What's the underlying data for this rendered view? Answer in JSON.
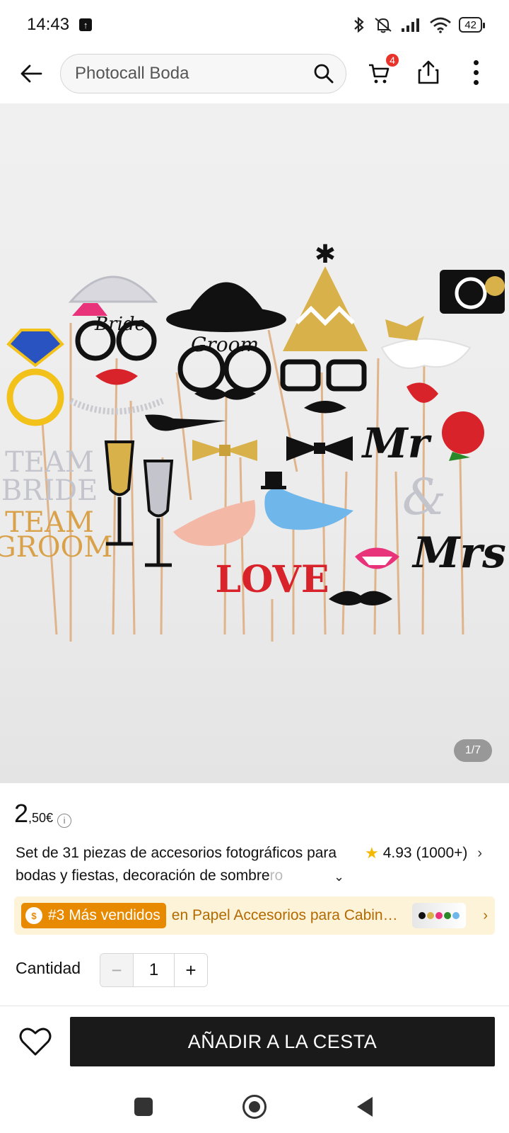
{
  "status_bar": {
    "time": "14:43",
    "battery": "42",
    "icons": [
      "upload-icon",
      "bluetooth-icon",
      "mute-icon",
      "signal-icon",
      "wifi-icon",
      "battery-icon"
    ]
  },
  "top_nav": {
    "search_value": "Photocall Boda",
    "cart_count": "4",
    "icons": [
      "back-arrow-icon",
      "search-icon",
      "cart-icon",
      "share-icon",
      "more-vertical-icon"
    ]
  },
  "gallery": {
    "counter": "1/7",
    "props": {
      "bride": "Bride",
      "groom": "Groom",
      "team_bride_1": "TEAM",
      "team_bride_2": "BRIDE",
      "team_groom_1": "TEAM",
      "team_groom_2": "GROOM",
      "mr": "Mr",
      "amp": "&",
      "mrs": "Mrs",
      "love": "LOVE"
    }
  },
  "product": {
    "price_int": "2",
    "price_dec": ",50€",
    "title_main": "Set de 31 piezas de accesorios fotográficos para bodas y fiestas, decoración de sombre",
    "title_fade": "ro",
    "rating": "4.93",
    "rating_count": "(1000+)"
  },
  "banner": {
    "rank": "#3 Más vendidos",
    "category": "en Papel Accesorios para Cabinas..."
  },
  "quantity": {
    "label": "Cantidad",
    "minus": "−",
    "value": "1",
    "plus": "+"
  },
  "actions": {
    "add_to_cart": "AÑADIR A LA CESTA"
  },
  "colors": {
    "accent_dark": "#1a1a1a",
    "badge_red": "#e8332b",
    "bestseller_orange": "#e88a00",
    "banner_bg": "#fdf3d9",
    "star_yellow": "#f5b800"
  }
}
